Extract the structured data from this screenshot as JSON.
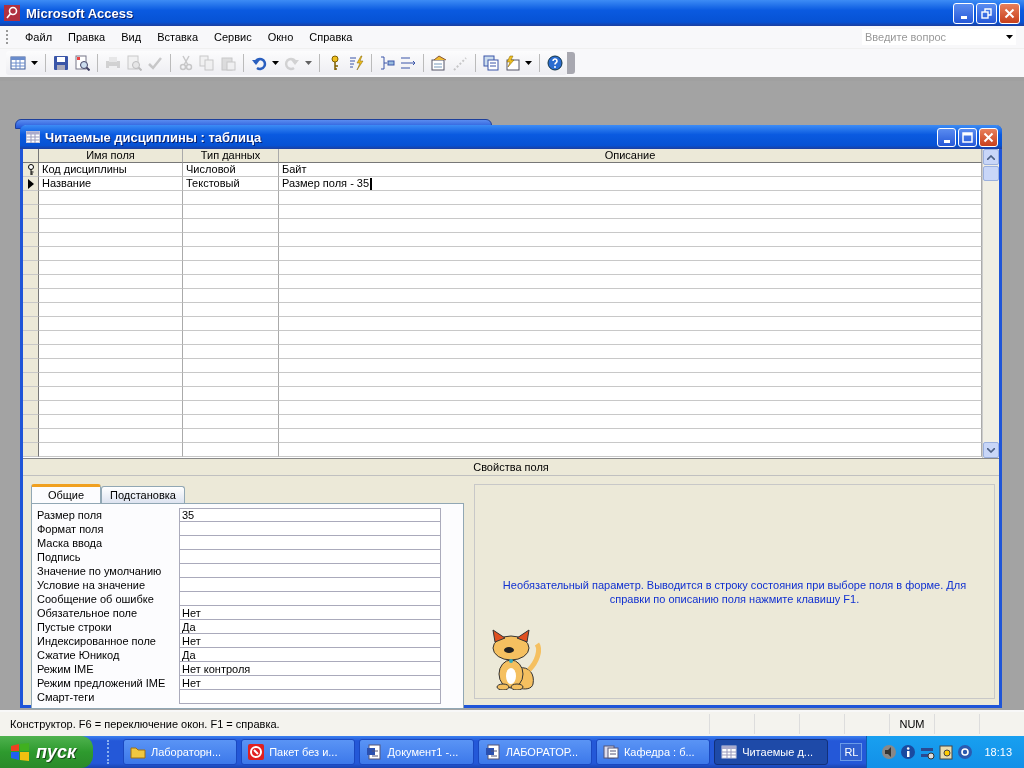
{
  "window": {
    "title": "Microsoft Access"
  },
  "menu": [
    "Файл",
    "Правка",
    "Вид",
    "Вставка",
    "Сервис",
    "Окно",
    "Справка"
  ],
  "help_search": {
    "placeholder": "Введите вопрос"
  },
  "table_window": {
    "title": "Читаемые дисциплины : таблица"
  },
  "columns": [
    "Имя поля",
    "Тип данных",
    "Описание"
  ],
  "rows": [
    {
      "primary_key": true,
      "current": false,
      "name": "Код дисциплины",
      "type": "Числовой",
      "description": "Байт"
    },
    {
      "primary_key": false,
      "current": true,
      "name": "Название",
      "type": "Текстовый",
      "description": "Размер поля - 35"
    }
  ],
  "properties_caption": "Свойства поля",
  "property_tabs": [
    {
      "label": "Общие",
      "selected": true
    },
    {
      "label": "Подстановка",
      "selected": false
    }
  ],
  "properties": [
    {
      "label": "Размер поля",
      "value": "35"
    },
    {
      "label": "Формат поля"
    },
    {
      "label": "Маска ввода"
    },
    {
      "label": "Подпись"
    },
    {
      "label": "Значение по умолчанию"
    },
    {
      "label": "Условие на значение"
    },
    {
      "label": "Сообщение об ошибке"
    },
    {
      "label": "Обязательное поле",
      "value": "Нет"
    },
    {
      "label": "Пустые строки",
      "value": "Да"
    },
    {
      "label": "Индексированное поле",
      "value": "Нет"
    },
    {
      "label": "Сжатие Юникод",
      "value": "Да"
    },
    {
      "label": "Режим IME",
      "value": "Нет контроля"
    },
    {
      "label": "Режим предложений IME",
      "value": "Нет"
    },
    {
      "label": "Смарт-теги"
    }
  ],
  "help_text": "Необязательный параметр.  Выводится в строку состояния при выборе поля в форме.  Для справки по описанию поля нажмите клавишу F1.",
  "status_bar": {
    "text": "Конструктор.  F6 = переключение окон.  F1 = справка.",
    "indicator": "NUM"
  },
  "taskbar": {
    "start": "пуск",
    "items": [
      {
        "label": "Лабораторн...",
        "kind": "folder",
        "selected": false
      },
      {
        "label": "Пакет без и...",
        "kind": "package",
        "selected": false
      },
      {
        "label": "Документ1 -...",
        "kind": "document",
        "selected": false
      },
      {
        "label": "ЛАБОРАТОР...",
        "kind": "document",
        "selected": false
      },
      {
        "label": "Кафедра : б...",
        "kind": "database",
        "selected": false
      },
      {
        "label": "Читаемые д...",
        "kind": "table",
        "selected": true
      }
    ],
    "language": "RL",
    "clock": "18:13"
  }
}
